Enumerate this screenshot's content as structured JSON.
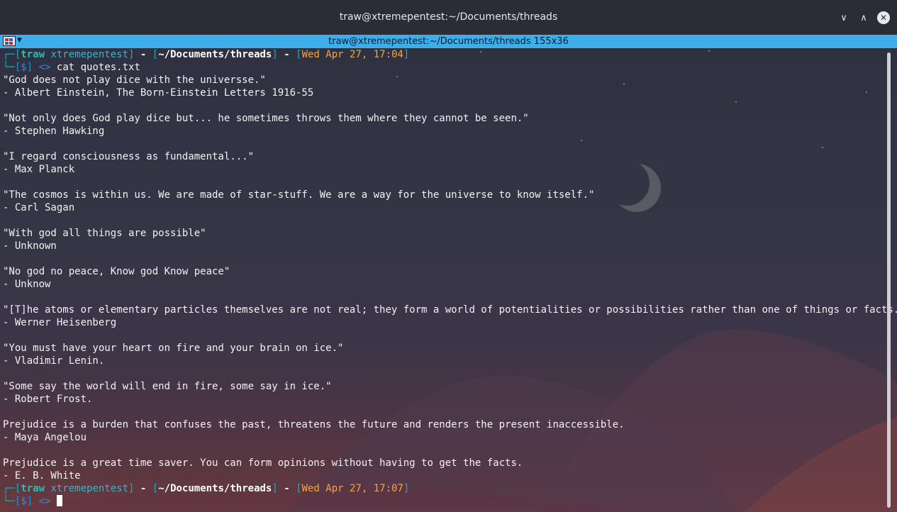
{
  "window": {
    "title": "traw@xtremepentest:~/Documents/threads",
    "min_glyph": "∨",
    "max_glyph": "∧",
    "close_glyph": "✕"
  },
  "tab": {
    "title": "traw@xtremepentest:~/Documents/threads 155x36",
    "menu_arrow": "▼"
  },
  "prompt1": {
    "user": "traw",
    "host": "xtremepentest",
    "path": "~/Documents/threads",
    "datetime": "Wed Apr 27, 17:04",
    "symbol": "[$]",
    "arrow": "<>",
    "command": "cat quotes.txt"
  },
  "output": [
    "\"God does not play dice with the universse.\"",
    "- Albert Einstein, The Born-Einstein Letters 1916-55",
    "",
    "\"Not only does God play dice but... he sometimes throws them where they cannot be seen.\"",
    "- Stephen Hawking",
    "",
    "\"I regard consciousness as fundamental...\"",
    "- Max Planck",
    "",
    "\"The cosmos is within us. We are made of star-stuff. We are a way for the universe to know itself.\"",
    "- Carl Sagan",
    "",
    "\"With god all things are possible\"",
    "- Unknown",
    "",
    "\"No god no peace, Know god Know peace\"",
    "- Unknow",
    "",
    "\"[T]he atoms or elementary particles themselves are not real; they form a world of potentialities or possibilities rather than one of things or facts.\"",
    "- Werner Heisenberg",
    "",
    "\"You must have your heart on fire and your brain on ice.\"",
    "- Vladimir Lenin.",
    "",
    "\"Some say the world will end in fire, some say in ice.\"",
    "- Robert Frost.",
    "",
    "Prejudice is a burden that confuses the past, threatens the future and renders the present inaccessible.",
    "- Maya Angelou",
    "",
    "Prejudice is a great time saver. You can form opinions without having to get the facts.",
    "- E. B. White"
  ],
  "prompt2": {
    "user": "traw",
    "host": "xtremepentest",
    "path": "~/Documents/threads",
    "datetime": "Wed Apr 27, 17:07",
    "symbol": "[$]",
    "arrow": "<>",
    "command": ""
  },
  "icons": [
    "chevron-down-icon",
    "chevron-up-icon",
    "close-icon",
    "terminal-menu-icon"
  ],
  "colors": {
    "tab_accent": "#3daee9",
    "prompt_frame": "#20a7b9",
    "prompt_user": "#26c0b2",
    "prompt_date": "#f3a63a"
  }
}
